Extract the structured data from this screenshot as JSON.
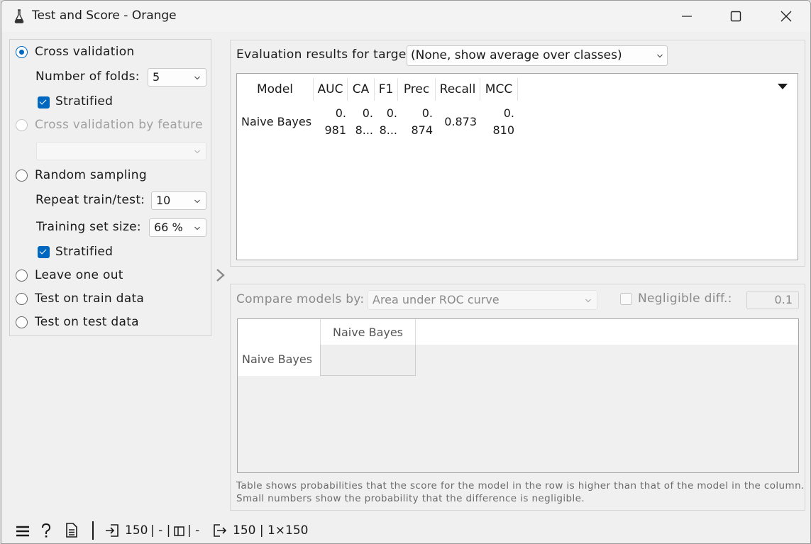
{
  "window": {
    "title": "Test and Score - Orange"
  },
  "sampling": {
    "cross_validation": "Cross validation",
    "folds_label": "Number of folds:",
    "folds_value": "5",
    "stratified_1": "Stratified",
    "cv_by_feature": "Cross validation by feature",
    "random_sampling": "Random sampling",
    "repeat_label": "Repeat train/test:",
    "repeat_value": "10",
    "train_size_label": "Training set size:",
    "train_size_value": "66 %",
    "stratified_2": "Stratified",
    "leave_one_out": "Leave one out",
    "test_on_train": "Test on train data",
    "test_on_test": "Test on test data"
  },
  "evaluation": {
    "target_label": "Evaluation results for target",
    "target_value": "(None, show average over classes)",
    "columns": [
      "Model",
      "AUC",
      "CA",
      "F1",
      "Prec",
      "Recall",
      "MCC"
    ],
    "row": {
      "model": "Naive Bayes",
      "auc_1": "0.",
      "auc_2": "981",
      "ca_1": "0.",
      "ca_2": "8...",
      "f1_1": "0.",
      "f1_2": "8...",
      "prec_1": "0.",
      "prec_2": "874",
      "recall": "0.873",
      "mcc_1": "0.",
      "mcc_2": "810"
    }
  },
  "compare": {
    "label": "Compare models by:",
    "value": "Area under ROC curve",
    "negligible_label": "Negligible diff.:",
    "negligible_value": "0.1",
    "col_header": "Naive Bayes",
    "row_header": "Naive Bayes",
    "note_line1": "Table shows probabilities that the score for the model in the row is higher than that of the model in the column.",
    "note_line2": "Small numbers show the probability that the difference is negligible."
  },
  "status": {
    "input_count": "150",
    "sep1": "| - |",
    "sep2": "| -",
    "output_summary": "150 | 1×150"
  }
}
